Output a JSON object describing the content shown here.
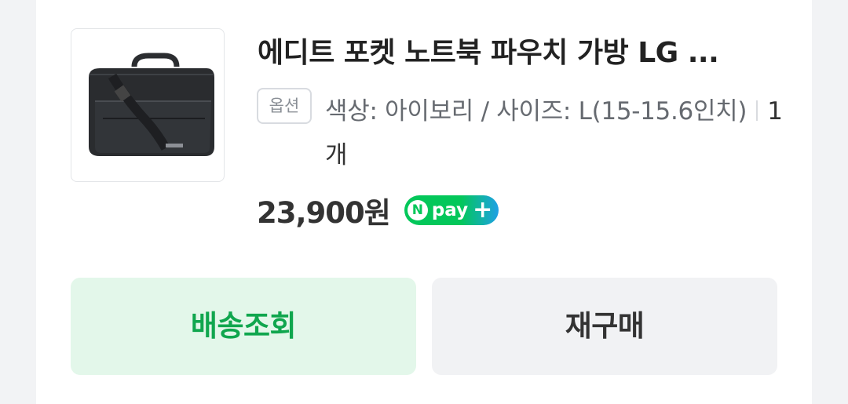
{
  "product": {
    "title": "에디트 포켓 노트북 파우치 가방 LG ...",
    "image_alt": "black laptop bag",
    "option_badge": "옵션",
    "option_text": "색상: 아이보리 / 사이즈: L(15-15.6인치)",
    "quantity": "1개",
    "price": "23,900원"
  },
  "npay": {
    "n": "N",
    "pay": "pay",
    "plus": "+"
  },
  "actions": {
    "track_label": "배송조회",
    "rebuy_label": "재구매"
  },
  "colors": {
    "track_bg": "#e3f7ea",
    "track_text": "#10a64e",
    "npay_green": "#03c75a"
  }
}
